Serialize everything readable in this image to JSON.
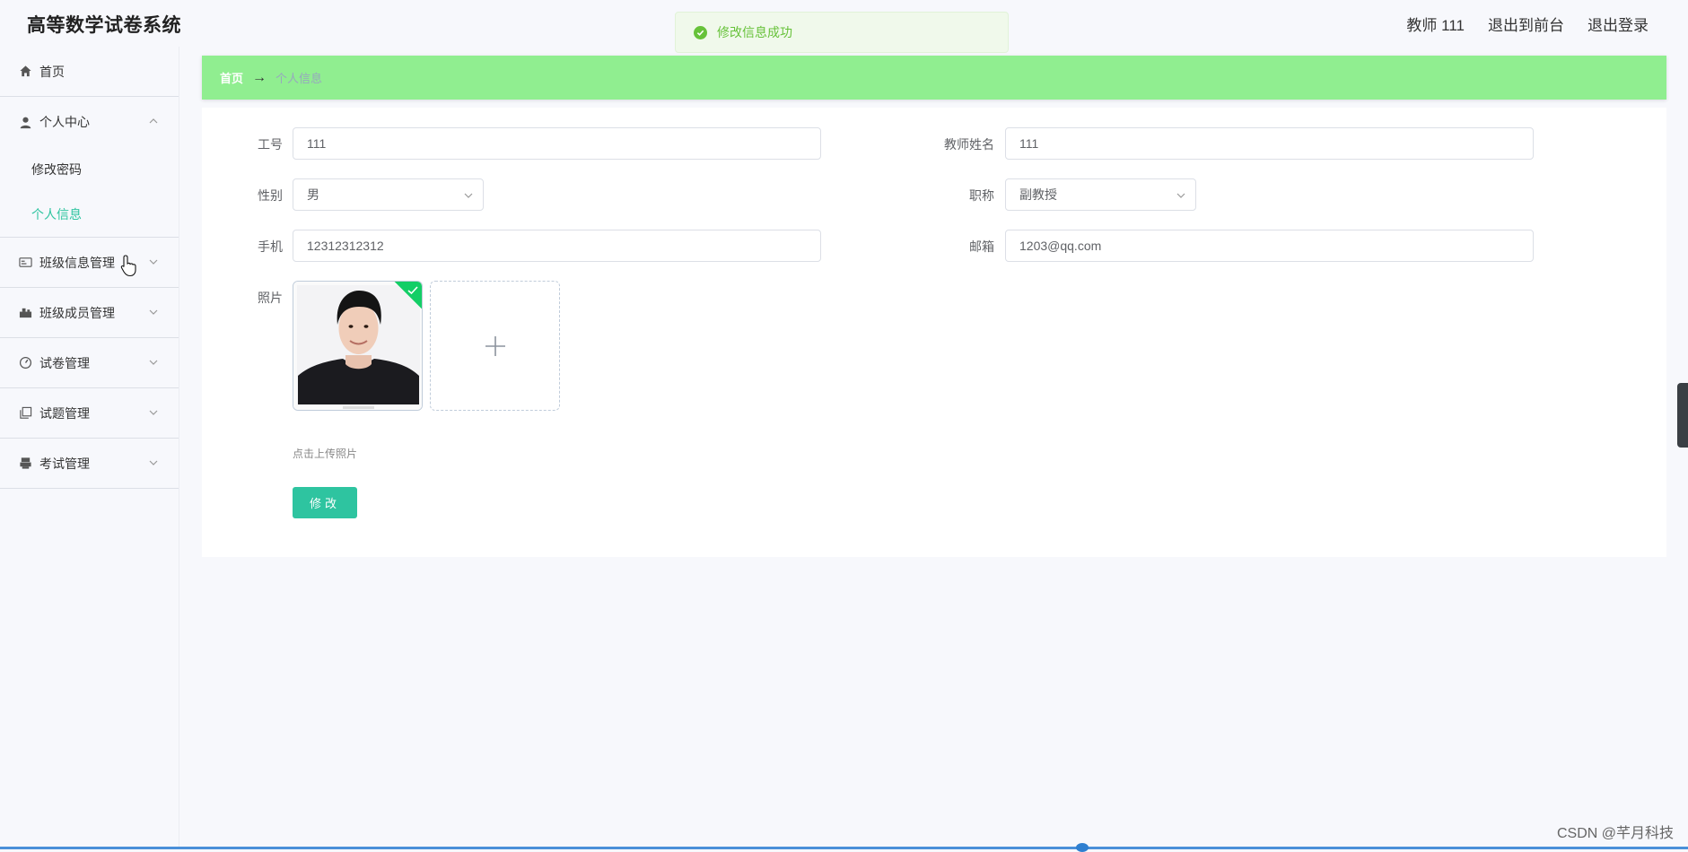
{
  "app": {
    "title": "高等数学试卷系统"
  },
  "header": {
    "links": [
      "教师 111",
      "退出到前台",
      "退出登录"
    ]
  },
  "toast": {
    "message": "修改信息成功",
    "color": "#67c23a"
  },
  "sidebar": {
    "items": [
      {
        "label": "首页",
        "icon": "home-icon"
      },
      {
        "label": "个人中心",
        "icon": "user-icon",
        "expanded": true,
        "children": [
          {
            "label": "修改密码",
            "active": false
          },
          {
            "label": "个人信息",
            "active": true
          }
        ]
      },
      {
        "label": "班级信息管理",
        "icon": "id-card-icon"
      },
      {
        "label": "班级成员管理",
        "icon": "group-icon"
      },
      {
        "label": "试卷管理",
        "icon": "gauge-icon"
      },
      {
        "label": "试题管理",
        "icon": "copy-icon"
      },
      {
        "label": "考试管理",
        "icon": "printer-icon"
      }
    ],
    "active_color": "#2ec4a0"
  },
  "breadcrumb": {
    "home": "首页",
    "current": "个人信息",
    "bg_color": "#90ee90"
  },
  "form": {
    "job_no_label": "工号",
    "job_no_value": "111",
    "teacher_name_label": "教师姓名",
    "teacher_name_value": "111",
    "gender_label": "性别",
    "gender_value": "男",
    "title_label": "职称",
    "title_value": "副教授",
    "phone_label": "手机",
    "phone_value": "12312312312",
    "email_label": "邮箱",
    "email_value": "1203@qq.com",
    "photo_label": "照片",
    "upload_hint": "点击上传照片",
    "submit_label": "修改"
  },
  "watermark": "CSDN @芊月科技",
  "accent_color": "#2ec4a0"
}
